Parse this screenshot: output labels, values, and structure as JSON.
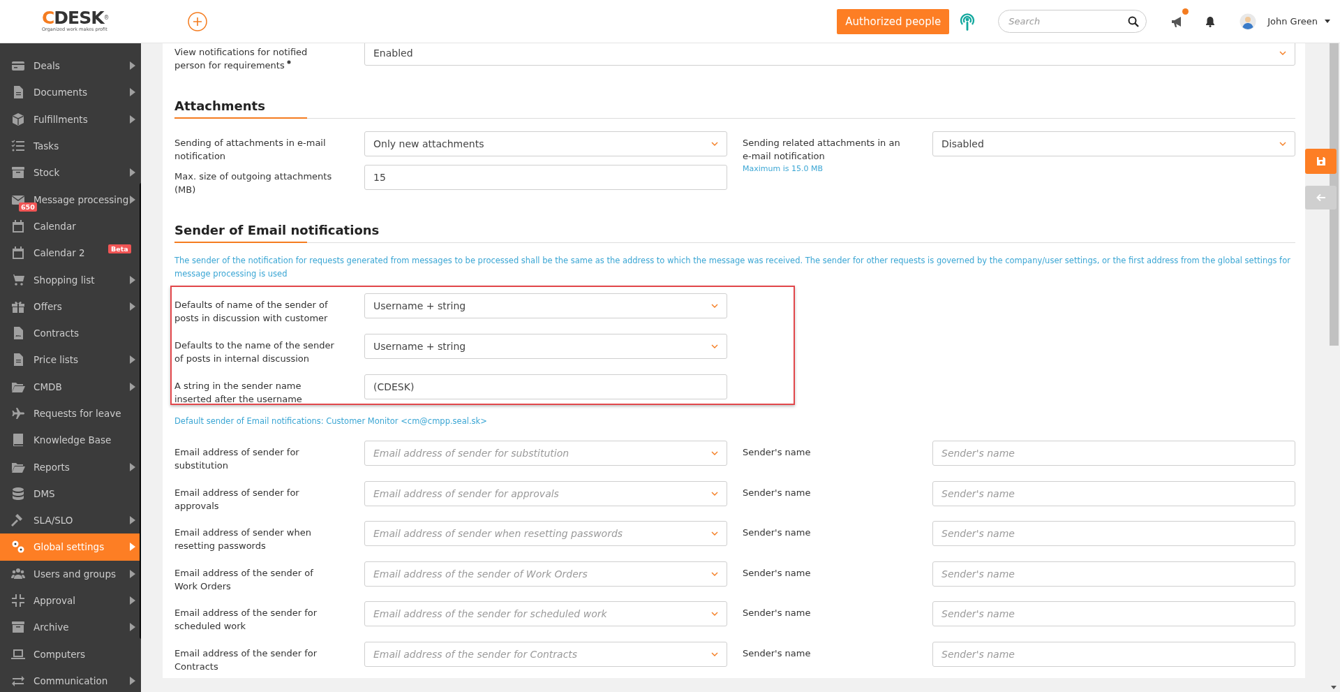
{
  "header": {
    "logo": "CDESK",
    "logo_mark": "®",
    "tagline": "Organized work makes profit",
    "authorized_button": "Authorized people",
    "search": {
      "placeholder": "Search"
    },
    "announcements_unread": true,
    "user": "John Green"
  },
  "sidebar": {
    "items": [
      {
        "label": "Deals",
        "submenu": true,
        "selected": false
      },
      {
        "label": "Documents",
        "submenu": true,
        "selected": false
      },
      {
        "label": "Fulfillments",
        "submenu": true,
        "selected": false
      },
      {
        "label": "Tasks",
        "submenu": false,
        "selected": false
      },
      {
        "label": "Stock",
        "submenu": true,
        "selected": false
      },
      {
        "label": "Message processing",
        "submenu": true,
        "selected": false,
        "badge": {
          "text": "650",
          "kind": "count"
        }
      },
      {
        "label": "Calendar",
        "submenu": false,
        "selected": false
      },
      {
        "label": "Calendar 2",
        "submenu": false,
        "selected": false,
        "badge": {
          "text": "Beta",
          "kind": "tag"
        }
      },
      {
        "label": "Shopping list",
        "submenu": true,
        "selected": false
      },
      {
        "label": "Offers",
        "submenu": true,
        "selected": false
      },
      {
        "label": "Contracts",
        "submenu": false,
        "selected": false
      },
      {
        "label": "Price lists",
        "submenu": true,
        "selected": false
      },
      {
        "label": "CMDB",
        "submenu": true,
        "selected": false
      },
      {
        "label": "Requests for leave",
        "submenu": false,
        "selected": false
      },
      {
        "label": "Knowledge Base",
        "submenu": false,
        "selected": false
      },
      {
        "label": "Reports",
        "submenu": true,
        "selected": false
      },
      {
        "label": "DMS",
        "submenu": false,
        "selected": false
      },
      {
        "label": "SLA/SLO",
        "submenu": true,
        "selected": false
      },
      {
        "label": "Global settings",
        "submenu": true,
        "selected": true
      },
      {
        "label": "Users and groups",
        "submenu": true,
        "selected": false
      },
      {
        "label": "Approval",
        "submenu": true,
        "selected": false
      },
      {
        "label": "Archive",
        "submenu": true,
        "selected": false
      },
      {
        "label": "Computers",
        "submenu": false,
        "selected": false
      },
      {
        "label": "Communication",
        "submenu": true,
        "selected": false
      }
    ]
  },
  "form": {
    "top_row": {
      "label": "View notifications for notified person for requirements",
      "hint_mark": true,
      "kind": "select",
      "value": "Enabled"
    },
    "sections": [
      {
        "title": "Attachments",
        "kind": "columns",
        "columns": [
          [
            {
              "label": "Sending of attachments in e-mail notification",
              "kind": "select",
              "value": "Only new attachments"
            },
            {
              "label": "Max. size of outgoing attachments (MB)",
              "kind": "input",
              "value": "15"
            }
          ],
          [
            {
              "label": "Sending related attachments in an e-mail notification",
              "note": "Maximum is 15.0 MB",
              "kind": "select",
              "value": "Disabled"
            }
          ]
        ]
      },
      {
        "title": "Sender of Email notifications",
        "kind": "blocks",
        "blocks": [
          {
            "kind": "note",
            "text": "The sender of the notification for requests generated from messages to be processed shall be the same as the address to which the message was received. The sender for other requests is governed by the company/user settings, or the first address from the global settings for message processing is used"
          },
          {
            "kind": "group",
            "highlighted": true,
            "rows": [
              [
                {
                  "label": "Defaults of name of the sender of posts in discussion with customer",
                  "kind": "select",
                  "value": "Username + string"
                }
              ],
              [
                {
                  "label": "Defaults to the name of the sender of posts in internal discussion",
                  "kind": "select",
                  "value": "Username + string"
                }
              ],
              [
                {
                  "label": "A string in the sender name inserted after the username",
                  "kind": "input",
                  "value": "(CDESK)"
                }
              ]
            ]
          },
          {
            "kind": "note",
            "text": "Default sender of Email notifications: Customer Monitor <cm@cmpp.seal.sk>"
          },
          {
            "kind": "group",
            "rows": [
              [
                {
                  "label": "Email address of sender for substitution",
                  "kind": "select",
                  "placeholder": "Email address of sender for substitution"
                },
                {
                  "label": "Sender's name",
                  "kind": "input",
                  "placeholder": "Sender's name"
                }
              ],
              [
                {
                  "label": "Email address of sender for approvals",
                  "kind": "select",
                  "placeholder": "Email address of sender for approvals"
                },
                {
                  "label": "Sender's name",
                  "kind": "input",
                  "placeholder": "Sender's name"
                }
              ],
              [
                {
                  "label": "Email address of sender when resetting passwords",
                  "kind": "select",
                  "placeholder": "Email address of sender when resetting passwords"
                },
                {
                  "label": "Sender's name",
                  "kind": "input",
                  "placeholder": "Sender's name"
                }
              ],
              [
                {
                  "label": "Email address of the sender of Work Orders",
                  "kind": "select",
                  "placeholder": "Email address of the sender of Work Orders"
                },
                {
                  "label": "Sender's name",
                  "kind": "input",
                  "placeholder": "Sender's name"
                }
              ],
              [
                {
                  "label": "Email address of the sender for scheduled work",
                  "kind": "select",
                  "placeholder": "Email address of the sender for scheduled work"
                },
                {
                  "label": "Sender's name",
                  "kind": "input",
                  "placeholder": "Sender's name"
                }
              ],
              [
                {
                  "label": "Email address of the sender for Contracts",
                  "kind": "select",
                  "placeholder": "Email address of the sender for Contracts"
                },
                {
                  "label": "Sender's name",
                  "kind": "input",
                  "placeholder": "Sender's name"
                }
              ]
            ]
          }
        ]
      }
    ]
  }
}
